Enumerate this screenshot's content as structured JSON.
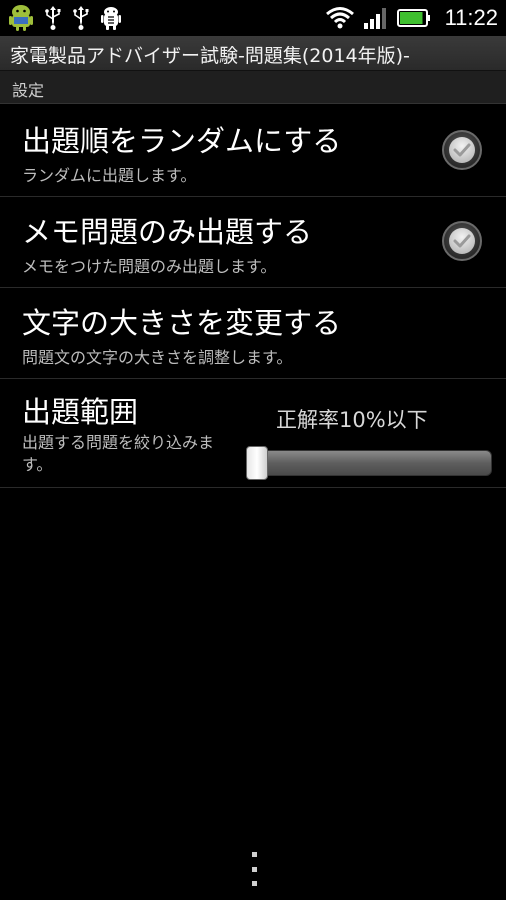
{
  "status_bar": {
    "time": "11:22",
    "icons_left": [
      "android-robot-icon",
      "usb-icon",
      "usb-icon",
      "debug-icon"
    ],
    "icons_right": [
      "wifi-icon",
      "signal-icon",
      "battery-icon"
    ],
    "battery_level_percent": 90
  },
  "app": {
    "title": "家電製品アドバイザー試験-問題集(2014年版)-"
  },
  "settings": {
    "header": "設定",
    "items": [
      {
        "title": "出題順をランダムにする",
        "summary": "ランダムに出題します。",
        "checked": true
      },
      {
        "title": "メモ問題のみ出題する",
        "summary": "メモをつけた問題のみ出題します。",
        "checked": true
      },
      {
        "title": "文字の大きさを変更する",
        "summary": "問題文の文字の大きさを調整します。"
      }
    ],
    "range": {
      "title": "出題範囲",
      "summary": "出題する問題を絞り込みます。",
      "value_label": "正解率10%以下",
      "slider_fraction": 0.0
    }
  },
  "colors": {
    "background": "#000000",
    "battery_green": "#3fbf2f",
    "android_green": "#9fbf3b"
  }
}
